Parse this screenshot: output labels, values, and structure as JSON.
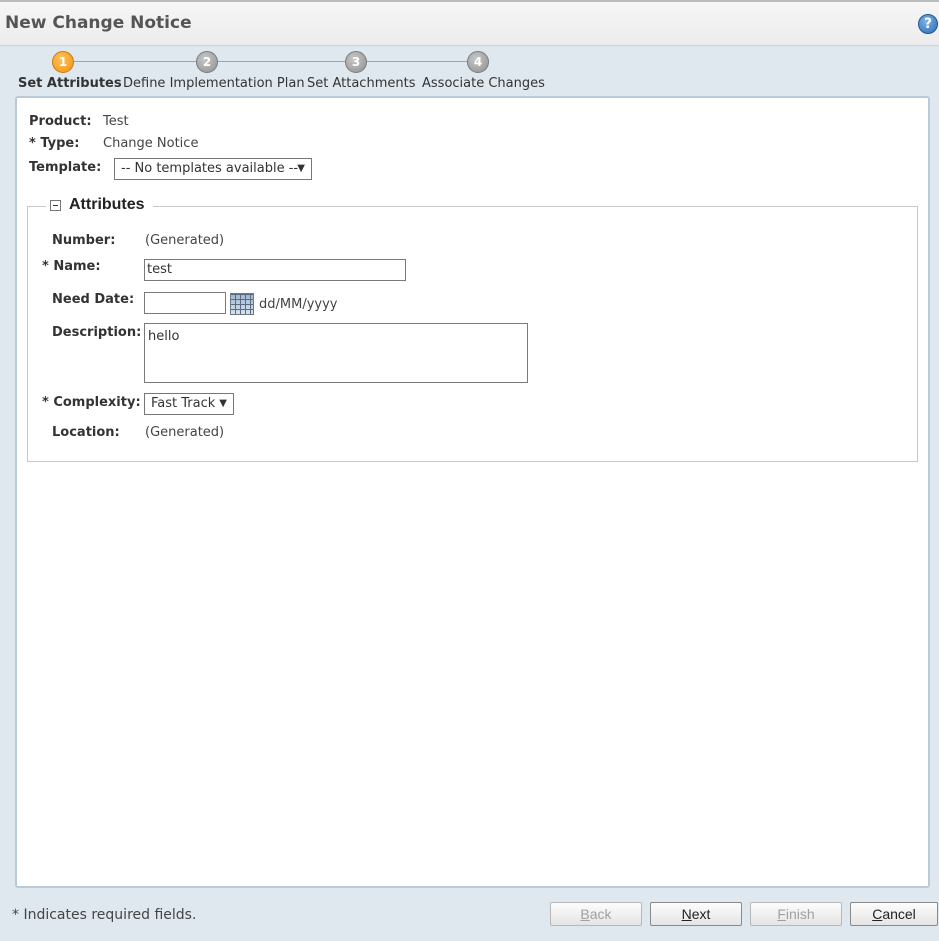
{
  "window": {
    "title": "New Change Notice",
    "help_icon": "question-mark-icon",
    "help_glyph": "?"
  },
  "steps": [
    {
      "number": "1",
      "label": "Set Attributes",
      "active": true
    },
    {
      "number": "2",
      "label": "Define Implementation Plan",
      "active": false
    },
    {
      "number": "3",
      "label": "Set Attachments",
      "active": false
    },
    {
      "number": "4",
      "label": "Associate Changes",
      "active": false
    }
  ],
  "header_fields": {
    "product_label": "Product:",
    "product_value": "Test",
    "type_label": "* Type:",
    "type_value": "Change Notice",
    "template_label": "Template:",
    "template_selected": "-- No templates available --"
  },
  "attributes": {
    "legend": "Attributes",
    "number_label": "Number:",
    "number_value": "(Generated)",
    "name_label": "* Name:",
    "name_value": "test",
    "need_date_label": "Need Date:",
    "need_date_value": "",
    "need_date_format": "dd/MM/yyyy",
    "description_label": "Description:",
    "description_value": "hello",
    "complexity_label": "* Complexity:",
    "complexity_selected": "Fast Track",
    "location_label": "Location:",
    "location_value": "(Generated)"
  },
  "footer": {
    "required_note": "* Indicates required fields.",
    "buttons": {
      "back": {
        "first": "B",
        "rest": "ack",
        "enabled": false
      },
      "next": {
        "first": "N",
        "rest": "ext",
        "enabled": true
      },
      "finish": {
        "first": "F",
        "rest": "inish",
        "enabled": false
      },
      "cancel": {
        "first": "C",
        "rest": "ancel",
        "enabled": true
      }
    }
  },
  "colors": {
    "accent_step": "#f0920e",
    "background": "#dfe8ef",
    "panel_border": "#b9cad8"
  }
}
